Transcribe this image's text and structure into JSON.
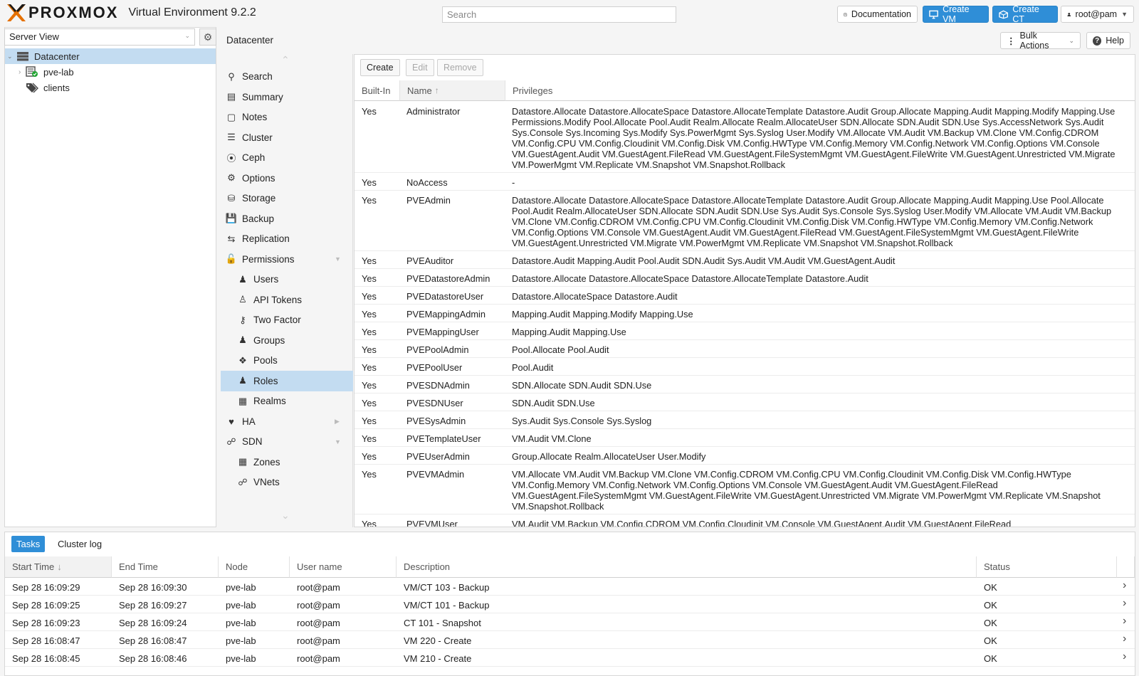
{
  "header": {
    "brand": "PROXMOX",
    "product": "Virtual Environment 9.2.2",
    "search_placeholder": "Search",
    "documentation_label": "Documentation",
    "create_vm_label": "Create VM",
    "create_ct_label": "Create CT",
    "user_label": "root@pam"
  },
  "tree": {
    "view_label": "Server View",
    "items": [
      {
        "label": "Datacenter",
        "icon": "datacenter-icon"
      },
      {
        "label": "pve-lab",
        "icon": "node-icon"
      },
      {
        "label": "clients",
        "icon": "tags-icon"
      }
    ]
  },
  "content": {
    "title": "Datacenter",
    "bulk_actions_label": "Bulk Actions",
    "help_label": "Help"
  },
  "nav": {
    "items": [
      {
        "label": "Search",
        "icon": "search-icon"
      },
      {
        "label": "Summary",
        "icon": "book-icon"
      },
      {
        "label": "Notes",
        "icon": "notes-icon"
      },
      {
        "label": "Cluster",
        "icon": "server-icon"
      },
      {
        "label": "Ceph",
        "icon": "ceph-icon"
      },
      {
        "label": "Options",
        "icon": "gear-icon"
      },
      {
        "label": "Storage",
        "icon": "database-icon"
      },
      {
        "label": "Backup",
        "icon": "floppy-icon"
      },
      {
        "label": "Replication",
        "icon": "retweet-icon"
      },
      {
        "label": "Permissions",
        "icon": "unlock-icon"
      },
      {
        "label": "Users",
        "icon": "user-icon"
      },
      {
        "label": "API Tokens",
        "icon": "user-outline-icon"
      },
      {
        "label": "Two Factor",
        "icon": "key-icon"
      },
      {
        "label": "Groups",
        "icon": "users-icon"
      },
      {
        "label": "Pools",
        "icon": "tags-icon"
      },
      {
        "label": "Roles",
        "icon": "male-icon"
      },
      {
        "label": "Realms",
        "icon": "address-book-icon"
      },
      {
        "label": "HA",
        "icon": "heartbeat-icon"
      },
      {
        "label": "SDN",
        "icon": "sdn-icon"
      },
      {
        "label": "Zones",
        "icon": "grid-icon"
      },
      {
        "label": "VNets",
        "icon": "network-icon"
      }
    ]
  },
  "roles": {
    "toolbar": {
      "create": "Create",
      "edit": "Edit",
      "remove": "Remove"
    },
    "columns": [
      "Built-In",
      "Name",
      "Privileges"
    ],
    "rows": [
      {
        "builtin": "Yes",
        "name": "Administrator",
        "privs": "Datastore.Allocate Datastore.AllocateSpace Datastore.AllocateTemplate Datastore.Audit Group.Allocate Mapping.Audit Mapping.Modify Mapping.Use Permissions.Modify Pool.Allocate Pool.Audit Realm.Allocate Realm.AllocateUser SDN.Allocate SDN.Audit SDN.Use Sys.AccessNetwork Sys.Audit Sys.Console Sys.Incoming Sys.Modify Sys.PowerMgmt Sys.Syslog User.Modify VM.Allocate VM.Audit VM.Backup VM.Clone VM.Config.CDROM VM.Config.CPU VM.Config.Cloudinit VM.Config.Disk VM.Config.HWType VM.Config.Memory VM.Config.Network VM.Config.Options VM.Console VM.GuestAgent.Audit VM.GuestAgent.FileRead VM.GuestAgent.FileSystemMgmt VM.GuestAgent.FileWrite VM.GuestAgent.Unrestricted VM.Migrate VM.PowerMgmt VM.Replicate VM.Snapshot VM.Snapshot.Rollback"
      },
      {
        "builtin": "Yes",
        "name": "NoAccess",
        "privs": "-"
      },
      {
        "builtin": "Yes",
        "name": "PVEAdmin",
        "privs": "Datastore.Allocate Datastore.AllocateSpace Datastore.AllocateTemplate Datastore.Audit Group.Allocate Mapping.Audit Mapping.Use Pool.Allocate Pool.Audit Realm.AllocateUser SDN.Allocate SDN.Audit SDN.Use Sys.Audit Sys.Console Sys.Syslog User.Modify VM.Allocate VM.Audit VM.Backup VM.Clone VM.Config.CDROM VM.Config.CPU VM.Config.Cloudinit VM.Config.Disk VM.Config.HWType VM.Config.Memory VM.Config.Network VM.Config.Options VM.Console VM.GuestAgent.Audit VM.GuestAgent.FileRead VM.GuestAgent.FileSystemMgmt VM.GuestAgent.FileWrite VM.GuestAgent.Unrestricted VM.Migrate VM.PowerMgmt VM.Replicate VM.Snapshot VM.Snapshot.Rollback"
      },
      {
        "builtin": "Yes",
        "name": "PVEAuditor",
        "privs": "Datastore.Audit Mapping.Audit Pool.Audit SDN.Audit Sys.Audit VM.Audit VM.GuestAgent.Audit"
      },
      {
        "builtin": "Yes",
        "name": "PVEDatastoreAdmin",
        "privs": "Datastore.Allocate Datastore.AllocateSpace Datastore.AllocateTemplate Datastore.Audit"
      },
      {
        "builtin": "Yes",
        "name": "PVEDatastoreUser",
        "privs": "Datastore.AllocateSpace Datastore.Audit"
      },
      {
        "builtin": "Yes",
        "name": "PVEMappingAdmin",
        "privs": "Mapping.Audit Mapping.Modify Mapping.Use"
      },
      {
        "builtin": "Yes",
        "name": "PVEMappingUser",
        "privs": "Mapping.Audit Mapping.Use"
      },
      {
        "builtin": "Yes",
        "name": "PVEPoolAdmin",
        "privs": "Pool.Allocate Pool.Audit"
      },
      {
        "builtin": "Yes",
        "name": "PVEPoolUser",
        "privs": "Pool.Audit"
      },
      {
        "builtin": "Yes",
        "name": "PVESDNAdmin",
        "privs": "SDN.Allocate SDN.Audit SDN.Use"
      },
      {
        "builtin": "Yes",
        "name": "PVESDNUser",
        "privs": "SDN.Audit SDN.Use"
      },
      {
        "builtin": "Yes",
        "name": "PVESysAdmin",
        "privs": "Sys.Audit Sys.Console Sys.Syslog"
      },
      {
        "builtin": "Yes",
        "name": "PVETemplateUser",
        "privs": "VM.Audit VM.Clone"
      },
      {
        "builtin": "Yes",
        "name": "PVEUserAdmin",
        "privs": "Group.Allocate Realm.AllocateUser User.Modify"
      },
      {
        "builtin": "Yes",
        "name": "PVEVMAdmin",
        "privs": "VM.Allocate VM.Audit VM.Backup VM.Clone VM.Config.CDROM VM.Config.CPU VM.Config.Cloudinit VM.Config.Disk VM.Config.HWType VM.Config.Memory VM.Config.Network VM.Config.Options VM.Console VM.GuestAgent.Audit VM.GuestAgent.FileRead VM.GuestAgent.FileSystemMgmt VM.GuestAgent.FileWrite VM.GuestAgent.Unrestricted VM.Migrate VM.PowerMgmt VM.Replicate VM.Snapshot VM.Snapshot.Rollback"
      },
      {
        "builtin": "Yes",
        "name": "PVEVMUser",
        "privs": "VM.Audit VM.Backup VM.Config.CDROM VM.Config.Cloudinit VM.Console VM.GuestAgent.Audit VM.GuestAgent.FileRead"
      }
    ]
  },
  "bottom": {
    "tabs": [
      "Tasks",
      "Cluster log"
    ],
    "columns": [
      "Start Time",
      "End Time",
      "Node",
      "User name",
      "Description",
      "Status"
    ],
    "rows": [
      {
        "start": "Sep 28 16:09:29",
        "end": "Sep 28 16:09:30",
        "node": "pve-lab",
        "user": "root@pam",
        "desc": "VM/CT 103 - Backup",
        "status": "OK"
      },
      {
        "start": "Sep 28 16:09:25",
        "end": "Sep 28 16:09:27",
        "node": "pve-lab",
        "user": "root@pam",
        "desc": "VM/CT 101 - Backup",
        "status": "OK"
      },
      {
        "start": "Sep 28 16:09:23",
        "end": "Sep 28 16:09:24",
        "node": "pve-lab",
        "user": "root@pam",
        "desc": "CT 101 - Snapshot",
        "status": "OK"
      },
      {
        "start": "Sep 28 16:08:47",
        "end": "Sep 28 16:08:47",
        "node": "pve-lab",
        "user": "root@pam",
        "desc": "VM 220 - Create",
        "status": "OK"
      },
      {
        "start": "Sep 28 16:08:45",
        "end": "Sep 28 16:08:46",
        "node": "pve-lab",
        "user": "root@pam",
        "desc": "VM 210 - Create",
        "status": "OK"
      }
    ]
  },
  "colors": {
    "accent": "#2f8ed7",
    "logo_orange": "#e57000",
    "selected": "#c3dcf1"
  }
}
